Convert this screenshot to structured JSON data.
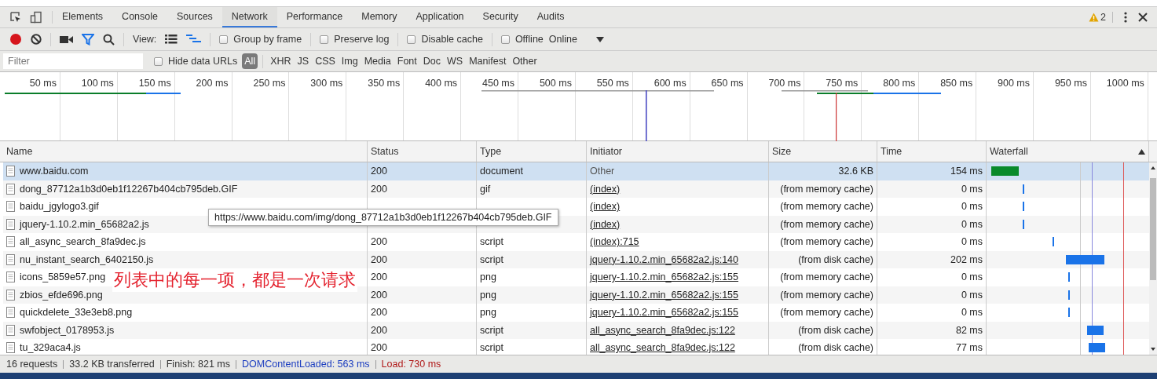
{
  "devtools_tabs": [
    {
      "label": "Elements",
      "selected": false
    },
    {
      "label": "Console",
      "selected": false
    },
    {
      "label": "Sources",
      "selected": false
    },
    {
      "label": "Network",
      "selected": true
    },
    {
      "label": "Performance",
      "selected": false
    },
    {
      "label": "Memory",
      "selected": false
    },
    {
      "label": "Application",
      "selected": false
    },
    {
      "label": "Security",
      "selected": false
    },
    {
      "label": "Audits",
      "selected": false
    }
  ],
  "warnings": {
    "count": "2"
  },
  "toolbar": {
    "recording": true,
    "view_label": "View:",
    "checkboxes": [
      {
        "label": "Group by frame",
        "checked": false
      },
      {
        "label": "Preserve log",
        "checked": false
      },
      {
        "label": "Disable cache",
        "checked": false
      },
      {
        "label": "Offline",
        "checked": false
      }
    ],
    "throttling": "Online"
  },
  "filter_bar": {
    "placeholder": "Filter",
    "hide_data_urls": {
      "label": "Hide data URLs",
      "checked": false
    },
    "types": [
      {
        "label": "All",
        "selected": true
      },
      {
        "label": "XHR",
        "selected": false
      },
      {
        "label": "JS",
        "selected": false
      },
      {
        "label": "CSS",
        "selected": false
      },
      {
        "label": "Img",
        "selected": false
      },
      {
        "label": "Media",
        "selected": false
      },
      {
        "label": "Font",
        "selected": false
      },
      {
        "label": "Doc",
        "selected": false
      },
      {
        "label": "WS",
        "selected": false
      },
      {
        "label": "Manifest",
        "selected": false
      },
      {
        "label": "Other",
        "selected": false
      }
    ]
  },
  "overview": {
    "ticks": [
      "50 ms",
      "100 ms",
      "150 ms",
      "200 ms",
      "250 ms",
      "300 ms",
      "350 ms",
      "400 ms",
      "450 ms",
      "500 ms",
      "550 ms",
      "600 ms",
      "650 ms",
      "700 ms",
      "750 ms",
      "800 ms",
      "850 ms",
      "900 ms",
      "950 ms",
      "1000 ms"
    ]
  },
  "table": {
    "columns": [
      "Name",
      "Status",
      "Type",
      "Initiator",
      "Size",
      "Time",
      "Waterfall"
    ],
    "rows": [
      {
        "name": "www.baidu.com",
        "status": "200",
        "type": "document",
        "initiator": "Other",
        "initiator_link": false,
        "size": "32.6 KB",
        "time": "154 ms",
        "selected": true
      },
      {
        "name": "dong_87712a1b3d0eb1f12267b404cb795deb.GIF",
        "status": "200",
        "type": "gif",
        "initiator": "(index)",
        "initiator_link": true,
        "size": "(from memory cache)",
        "time": "0 ms",
        "selected": false
      },
      {
        "name": "baidu_jgylogo3.gif",
        "initiator": "(index)",
        "initiator_link": true,
        "size": "(from memory cache)",
        "time": "0 ms",
        "selected": false
      },
      {
        "name": "jquery-1.10.2.min_65682a2.js",
        "initiator": "(index)",
        "initiator_link": true,
        "size": "(from memory cache)",
        "time": "0 ms",
        "selected": false
      },
      {
        "name": "all_async_search_8fa9dec.js",
        "status": "200",
        "type": "script",
        "initiator": "(index):715",
        "initiator_link": true,
        "size": "(from memory cache)",
        "time": "0 ms",
        "selected": false
      },
      {
        "name": "nu_instant_search_6402150.js",
        "status": "200",
        "type": "script",
        "initiator": "jquery-1.10.2.min_65682a2.js:140",
        "initiator_link": true,
        "size": "(from disk cache)",
        "time": "202 ms",
        "selected": false
      },
      {
        "name": "icons_5859e57.png",
        "status": "200",
        "type": "png",
        "initiator": "jquery-1.10.2.min_65682a2.js:155",
        "initiator_link": true,
        "size": "(from memory cache)",
        "time": "0 ms",
        "selected": false
      },
      {
        "name": "zbios_efde696.png",
        "status": "200",
        "type": "png",
        "initiator": "jquery-1.10.2.min_65682a2.js:155",
        "initiator_link": true,
        "size": "(from memory cache)",
        "time": "0 ms",
        "selected": false
      },
      {
        "name": "quickdelete_33e3eb8.png",
        "status": "200",
        "type": "png",
        "initiator": "jquery-1.10.2.min_65682a2.js:155",
        "initiator_link": true,
        "size": "(from memory cache)",
        "time": "0 ms",
        "selected": false
      },
      {
        "name": "swfobject_0178953.js",
        "status": "200",
        "type": "script",
        "initiator": "all_async_search_8fa9dec.js:122",
        "initiator_link": true,
        "size": "(from disk cache)",
        "time": "82 ms",
        "selected": false
      },
      {
        "name": "tu_329aca4.js",
        "status": "200",
        "type": "script",
        "initiator": "all_async_search_8fa9dec.js:122",
        "initiator_link": true,
        "size": "(from disk cache)",
        "time": "77 ms",
        "selected": false
      }
    ]
  },
  "tooltip": "https://www.baidu.com/img/dong_87712a1b3d0eb1f12267b404cb795deb.GIF",
  "annotation": "列表中的每一项，都是一次请求",
  "status_bar": [
    {
      "text": "16 requests",
      "kind": "plain"
    },
    {
      "text": "33.2 KB transferred",
      "kind": "plain"
    },
    {
      "text": "Finish: 821 ms",
      "kind": "plain"
    },
    {
      "text": "DOMContentLoaded: 563 ms",
      "kind": "dom"
    },
    {
      "text": "Load: 730 ms",
      "kind": "load"
    }
  ]
}
